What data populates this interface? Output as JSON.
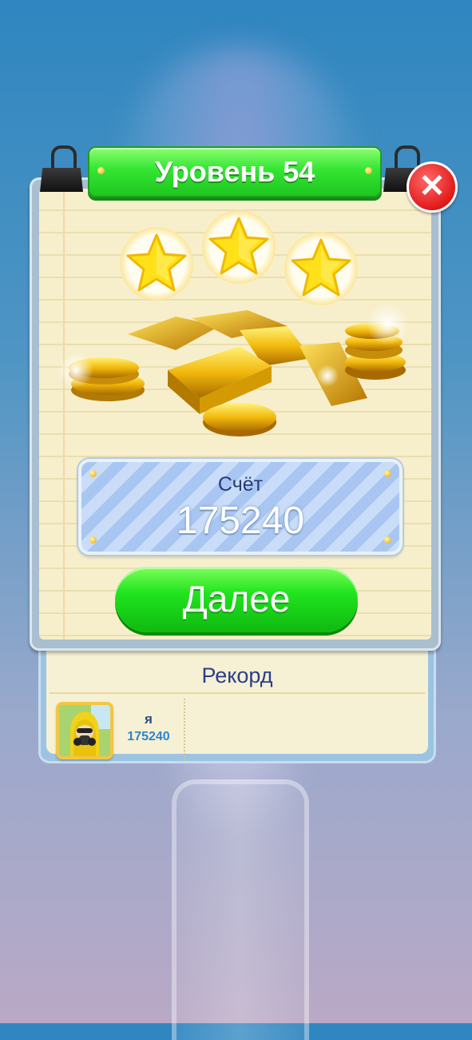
{
  "level": {
    "title": "Уровень 54"
  },
  "stars": {
    "earned": 3,
    "total": 3
  },
  "score": {
    "label": "Счёт",
    "value": "175240"
  },
  "next_button": {
    "label": "Далее"
  },
  "close_button": {
    "icon": "close-icon"
  },
  "leaderboard": {
    "title": "Рекорд",
    "entries": [
      {
        "name": "я",
        "score": "175240",
        "avatar": "hazmat-avatar"
      }
    ]
  },
  "colors": {
    "banner_green": "#34e534",
    "button_green": "#20e41e",
    "close_red": "#e11a1a",
    "score_blue": "#2e86c9",
    "title_navy": "#2a3f8a"
  }
}
